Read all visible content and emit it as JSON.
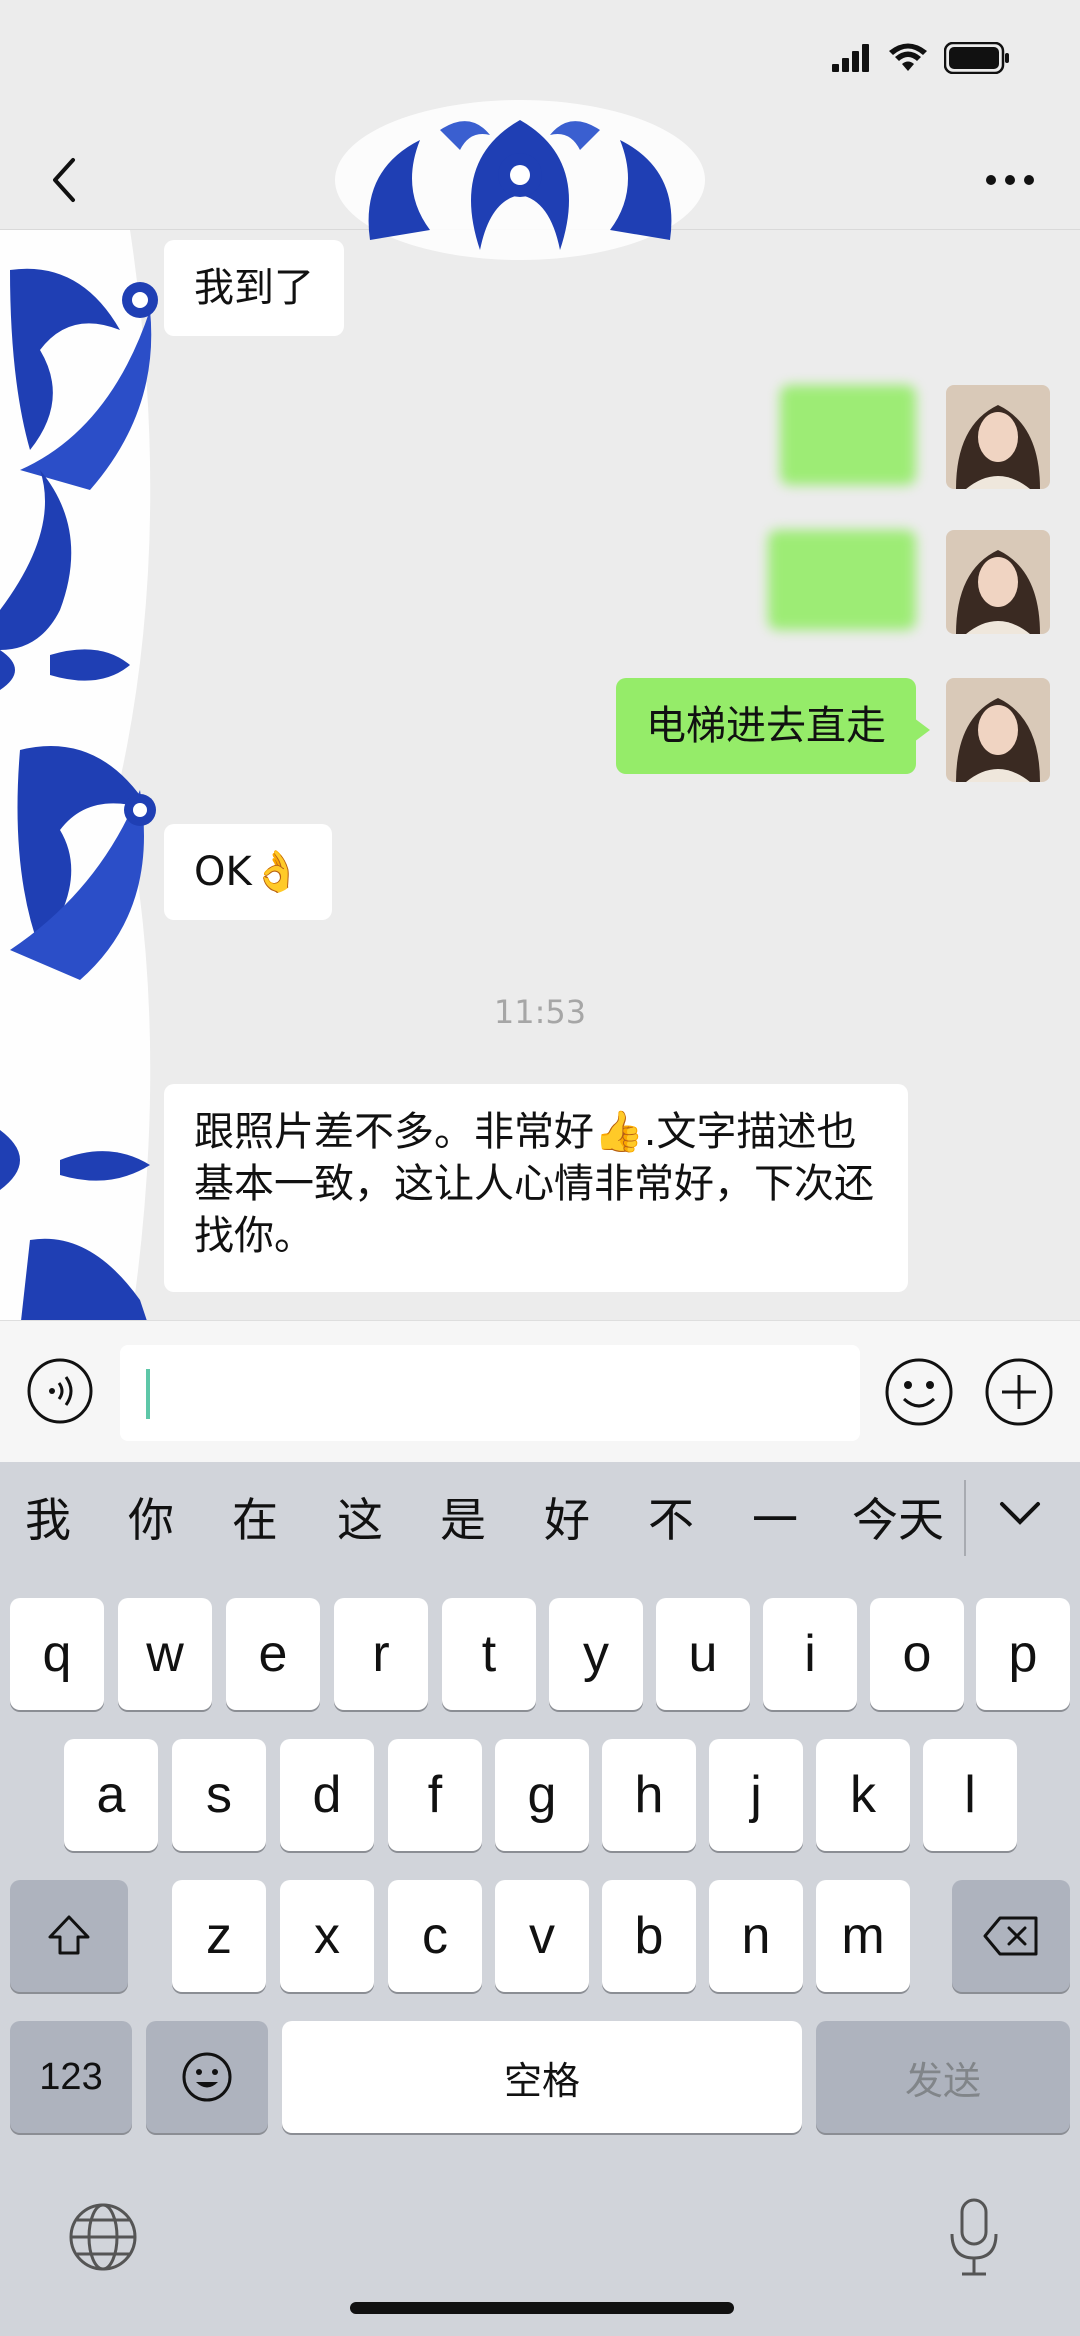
{
  "status": {
    "signal_icon": "signal-icon",
    "wifi_icon": "wifi-icon",
    "battery_icon": "battery-icon"
  },
  "nav": {
    "back_icon": "chevron-left-icon",
    "more_icon": "more-dots-icon"
  },
  "messages": [
    {
      "side": "left",
      "text": "我到了"
    },
    {
      "side": "right",
      "text": ""
    },
    {
      "side": "right",
      "text": ""
    },
    {
      "side": "right",
      "text": "电梯进去直走"
    },
    {
      "side": "left",
      "text": "OK👌"
    },
    {
      "side": "left",
      "text": "跟照片差不多。非常好👍.文字描述也基本一致，这让人心情非常好，下次还找你。"
    }
  ],
  "timestamp": "11:53",
  "input": {
    "value": "",
    "voice_icon": "voice-icon",
    "emoji_icon": "emoji-icon",
    "plus_icon": "plus-icon"
  },
  "keyboard": {
    "candidates": [
      "我",
      "你",
      "在",
      "这",
      "是",
      "好",
      "不",
      "一",
      "今天"
    ],
    "row1": [
      "q",
      "w",
      "e",
      "r",
      "t",
      "y",
      "u",
      "i",
      "o",
      "p"
    ],
    "row2": [
      "a",
      "s",
      "d",
      "f",
      "g",
      "h",
      "j",
      "k",
      "l"
    ],
    "row3": [
      "z",
      "x",
      "c",
      "v",
      "b",
      "n",
      "m"
    ],
    "numbers_label": "123",
    "space_label": "空格",
    "send_label": "发送",
    "shift_icon": "shift-icon",
    "delete_icon": "backspace-icon",
    "emoji_key_icon": "emoji-icon",
    "globe_icon": "globe-icon",
    "mic_icon": "microphone-icon",
    "collapse_icon": "chevron-down-icon"
  },
  "colors": {
    "self_bubble": "#95ec69",
    "other_bubble": "#ffffff",
    "ornament_blue": "#1f3fb4"
  }
}
